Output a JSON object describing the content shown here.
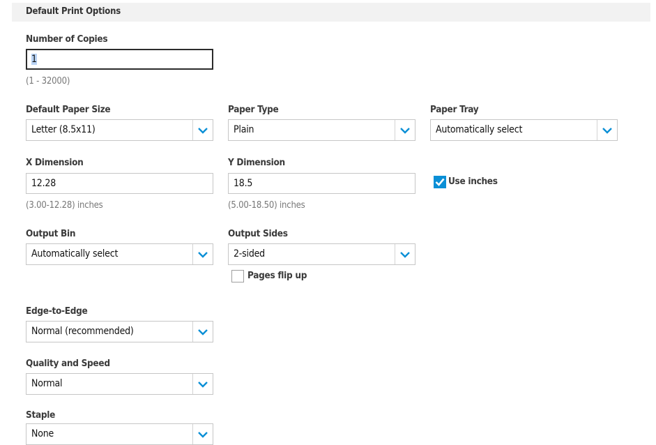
{
  "section": {
    "title": "Default Print Options"
  },
  "copies": {
    "label": "Number of Copies",
    "value": "1",
    "hint": "(1 - 32000)"
  },
  "paper_size": {
    "label": "Default Paper Size",
    "value": "Letter (8.5x11)"
  },
  "paper_type": {
    "label": "Paper Type",
    "value": "Plain"
  },
  "paper_tray": {
    "label": "Paper Tray",
    "value": "Automatically select"
  },
  "x_dimension": {
    "label": "X Dimension",
    "value": "12.28",
    "hint": "(3.00-12.28) inches"
  },
  "y_dimension": {
    "label": "Y Dimension",
    "value": "18.5",
    "hint": "(5.00-18.50) inches"
  },
  "use_inches": {
    "label": "Use inches",
    "checked": true
  },
  "output_bin": {
    "label": "Output Bin",
    "value": "Automatically select"
  },
  "output_sides": {
    "label": "Output Sides",
    "value": "2-sided"
  },
  "pages_flip_up": {
    "label": "Pages flip up",
    "checked": false
  },
  "edge_to_edge": {
    "label": "Edge-to-Edge",
    "value": "Normal (recommended)"
  },
  "quality_speed": {
    "label": "Quality and Speed",
    "value": "Normal"
  },
  "staple": {
    "label": "Staple",
    "value": "None"
  },
  "colors": {
    "accent": "#0a8fd6",
    "header_bg": "#f2f2f2",
    "border": "#c6c6c6"
  },
  "icons": {
    "dropdown": "chevron-down-icon",
    "check": "checkmark-icon"
  }
}
